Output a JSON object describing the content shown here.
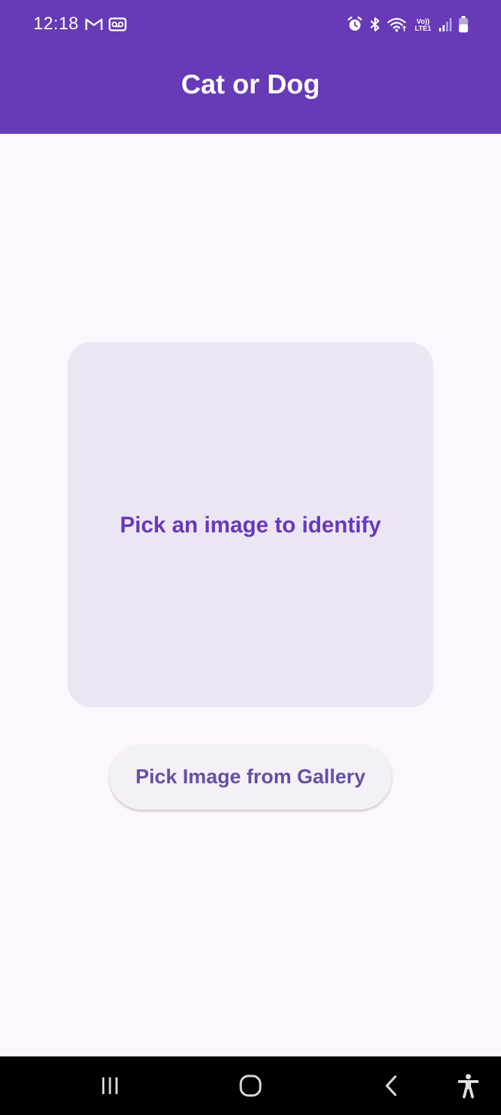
{
  "status_bar": {
    "time": "12:18",
    "network_label": "LTE1",
    "volte_label": "Vo))",
    "left_icons": [
      "gmail-icon",
      "voicemail-icon"
    ],
    "right_icons": [
      "alarm-icon",
      "bluetooth-icon",
      "wifi-icon",
      "volte-icon",
      "signal-icon",
      "battery-icon"
    ]
  },
  "app_bar": {
    "title": "Cat or Dog",
    "color": "#673ab7"
  },
  "main": {
    "placeholder_text": "Pick an image to identify",
    "pick_button_label": "Pick Image from Gallery"
  },
  "nav_bar": {
    "items": [
      "recents-icon",
      "home-icon",
      "back-icon",
      "accessibility-icon"
    ]
  }
}
